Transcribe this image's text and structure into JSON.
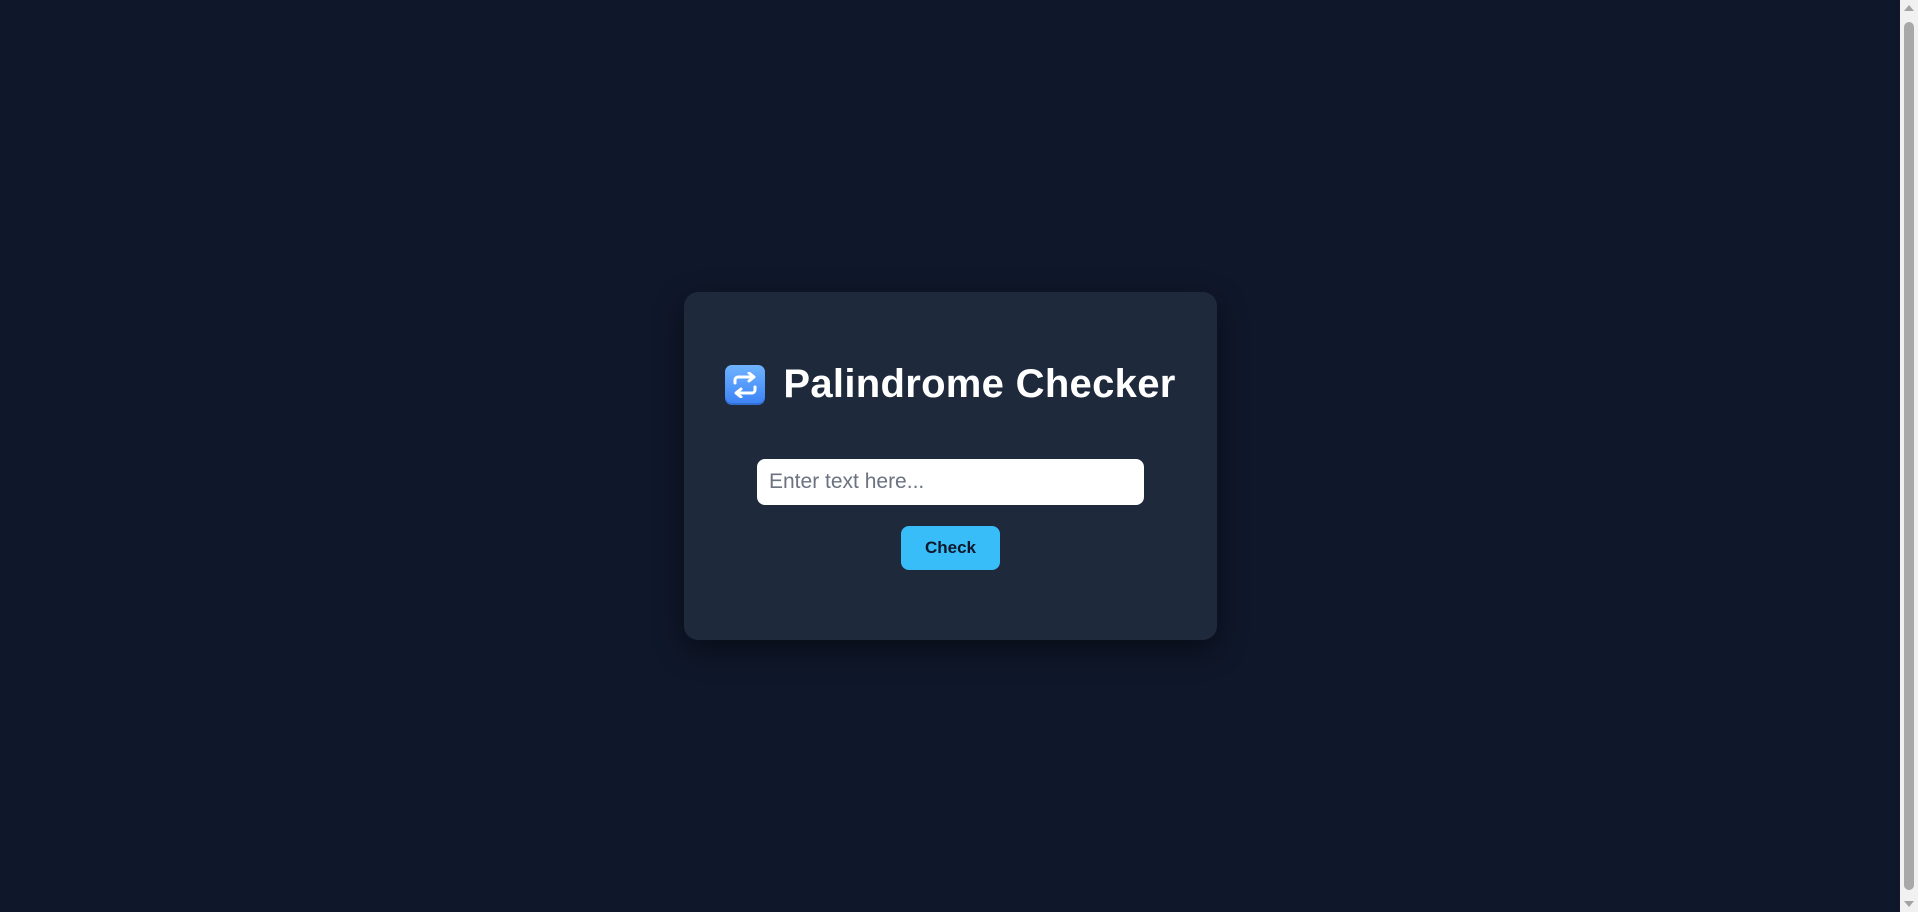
{
  "page": {
    "background": "#0f172a"
  },
  "card": {
    "title": "Palindrome Checker",
    "icon": "repeat-icon",
    "background": "#1e293b"
  },
  "input": {
    "value": "",
    "placeholder": "Enter text here..."
  },
  "button": {
    "label": "Check",
    "color": "#38bdf8"
  }
}
